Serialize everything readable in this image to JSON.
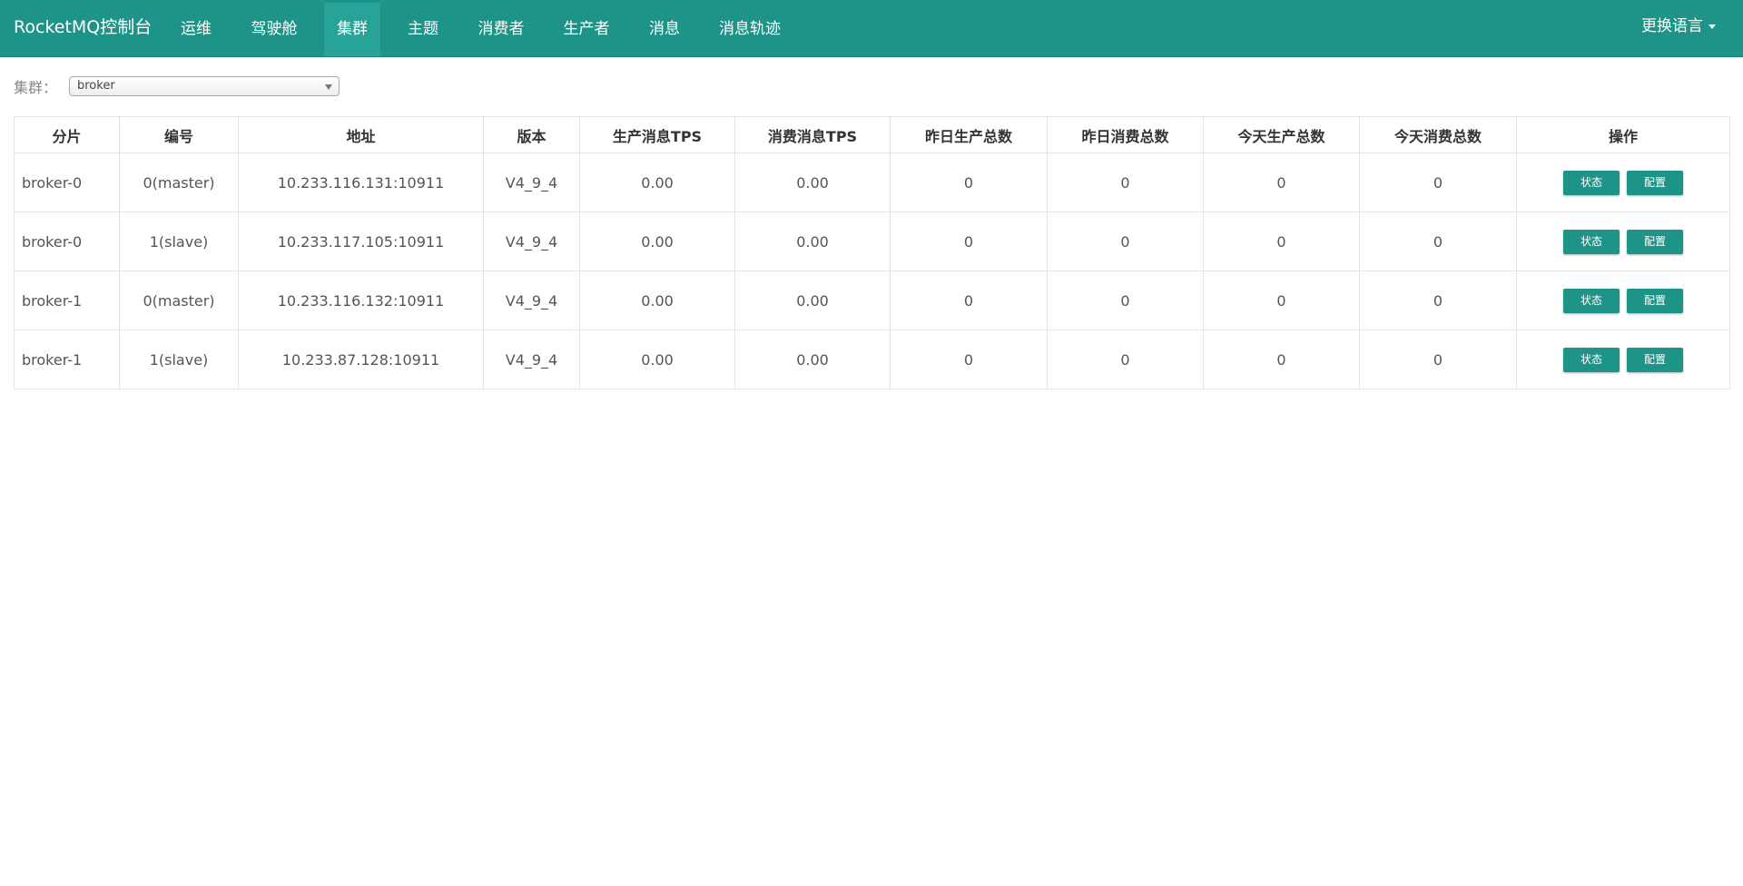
{
  "nav": {
    "brand": "RocketMQ控制台",
    "items": [
      {
        "label": "运维",
        "active": false
      },
      {
        "label": "驾驶舱",
        "active": false
      },
      {
        "label": "集群",
        "active": true
      },
      {
        "label": "主题",
        "active": false
      },
      {
        "label": "消费者",
        "active": false
      },
      {
        "label": "生产者",
        "active": false
      },
      {
        "label": "消息",
        "active": false
      },
      {
        "label": "消息轨迹",
        "active": false
      }
    ],
    "language": "更换语言",
    "colors": {
      "bar": "#1e9388",
      "active": "#27a398"
    }
  },
  "filter": {
    "label": "集群：",
    "selected": "broker"
  },
  "table": {
    "headers": [
      "分片",
      "编号",
      "地址",
      "版本",
      "生产消息TPS",
      "消费消息TPS",
      "昨日生产总数",
      "昨日消费总数",
      "今天生产总数",
      "今天消费总数",
      "操作"
    ],
    "rows": [
      {
        "shard": "broker-0",
        "id": "0(master)",
        "address": "10.233.116.131:10911",
        "version": "V4_9_4",
        "produce_tps": "0.00",
        "consume_tps": "0.00",
        "yesterday_produce": "0",
        "yesterday_consume": "0",
        "today_produce": "0",
        "today_consume": "0",
        "status_btn": "状态",
        "config_btn": "配置"
      },
      {
        "shard": "broker-0",
        "id": "1(slave)",
        "address": "10.233.117.105:10911",
        "version": "V4_9_4",
        "produce_tps": "0.00",
        "consume_tps": "0.00",
        "yesterday_produce": "0",
        "yesterday_consume": "0",
        "today_produce": "0",
        "today_consume": "0",
        "status_btn": "状态",
        "config_btn": "配置"
      },
      {
        "shard": "broker-1",
        "id": "0(master)",
        "address": "10.233.116.132:10911",
        "version": "V4_9_4",
        "produce_tps": "0.00",
        "consume_tps": "0.00",
        "yesterday_produce": "0",
        "yesterday_consume": "0",
        "today_produce": "0",
        "today_consume": "0",
        "status_btn": "状态",
        "config_btn": "配置"
      },
      {
        "shard": "broker-1",
        "id": "1(slave)",
        "address": "10.233.87.128:10911",
        "version": "V4_9_4",
        "produce_tps": "0.00",
        "consume_tps": "0.00",
        "yesterday_produce": "0",
        "yesterday_consume": "0",
        "today_produce": "0",
        "today_consume": "0",
        "status_btn": "状态",
        "config_btn": "配置"
      }
    ]
  }
}
